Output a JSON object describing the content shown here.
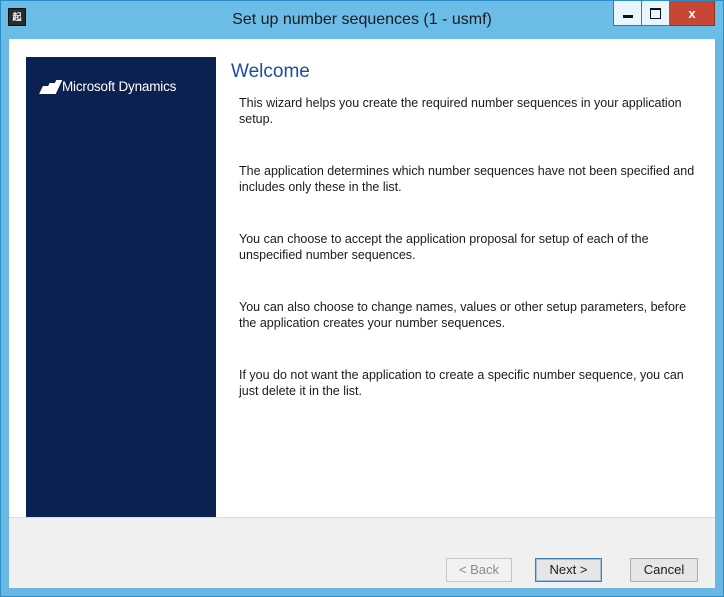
{
  "window": {
    "title": "Set up number sequences (1 - usmf)",
    "app_icon_text": "起",
    "controls": {
      "minimize": "minimize",
      "maximize": "maximize",
      "close": "x"
    }
  },
  "banner": {
    "brand": "Microsoft Dynamics",
    "background_color": "#0b2150"
  },
  "content": {
    "heading": "Welcome",
    "paragraphs": [
      "This wizard helps you create the required number sequences in your application setup.",
      "The application determines which number sequences have not been specified and includes only these in the list.",
      "You can choose to accept the application proposal for setup of each of the unspecified number sequences.",
      "You can also choose to change names, values or other setup parameters, before the application creates your number sequences.",
      "If you do not want the application to create a specific number sequence, you can just delete it in the list."
    ]
  },
  "buttons": {
    "back": "< Back",
    "next": "Next >",
    "cancel": "Cancel"
  }
}
